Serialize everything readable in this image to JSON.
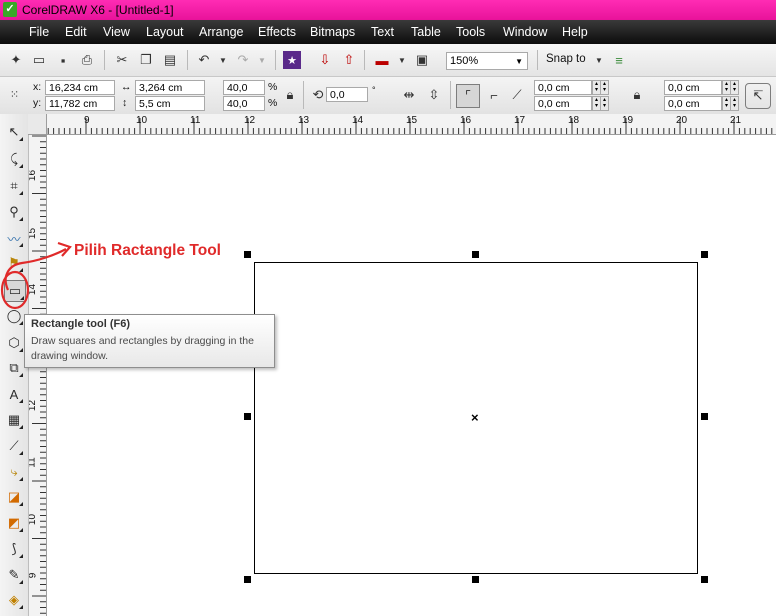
{
  "window": {
    "title": "CorelDRAW X6 - [Untitled-1]",
    "logo_icon": "coreldraw-logo-icon"
  },
  "menu": [
    "File",
    "Edit",
    "View",
    "Layout",
    "Arrange",
    "Effects",
    "Bitmaps",
    "Text",
    "Table",
    "Tools",
    "Window",
    "Help"
  ],
  "standard_toolbar": {
    "zoom_level": "150%",
    "snap_to_label": "Snap to"
  },
  "property_bar": {
    "x_label": "x:",
    "x_value": "16,234 cm",
    "y_label": "y:",
    "y_value": "11,782 cm",
    "width_value": "3,264 cm",
    "height_value": "5,5 cm",
    "scale_x": "40,0",
    "scale_y": "40,0",
    "percent": "%",
    "rotation": "0,0",
    "degree": "°",
    "corner_tl": "0,0 cm",
    "corner_bl": "0,0 cm",
    "corner_tr": "0,0 cm",
    "corner_br": "0,0 cm"
  },
  "ruler": {
    "horizontal_ticks": [
      "9",
      "10",
      "11",
      "12",
      "13",
      "14",
      "15",
      "16",
      "17",
      "18",
      "19",
      "20",
      "21"
    ],
    "vertical_ticks": [
      "16",
      "15",
      "14",
      "13",
      "12",
      "11",
      "10",
      "9"
    ]
  },
  "toolbox_icons": [
    "pick-tool-icon",
    "shape-tool-icon",
    "crop-tool-icon",
    "zoom-tool-icon",
    "freehand-tool-icon",
    "smart-fill-icon",
    "rectangle-tool-icon",
    "ellipse-tool-icon",
    "polygon-tool-icon",
    "basic-shapes-icon",
    "text-tool-icon",
    "table-tool-icon",
    "dimension-tool-icon",
    "connector-tool-icon",
    "blend-tool-icon",
    "transparency-tool-icon",
    "eyedropper-tool-icon",
    "outline-pen-icon",
    "fill-tool-icon",
    "interactive-fill-icon"
  ],
  "tooltip": {
    "title": "Rectangle tool (F6)",
    "description": "Draw squares and rectangles by dragging in the drawing window."
  },
  "annotation": {
    "text": "Pilih Ractangle Tool",
    "color": "#e02a2a"
  },
  "colors": {
    "titlebar": "#f21aa8",
    "menubar": "#1a1a1a",
    "annotation": "#e02a2a"
  }
}
